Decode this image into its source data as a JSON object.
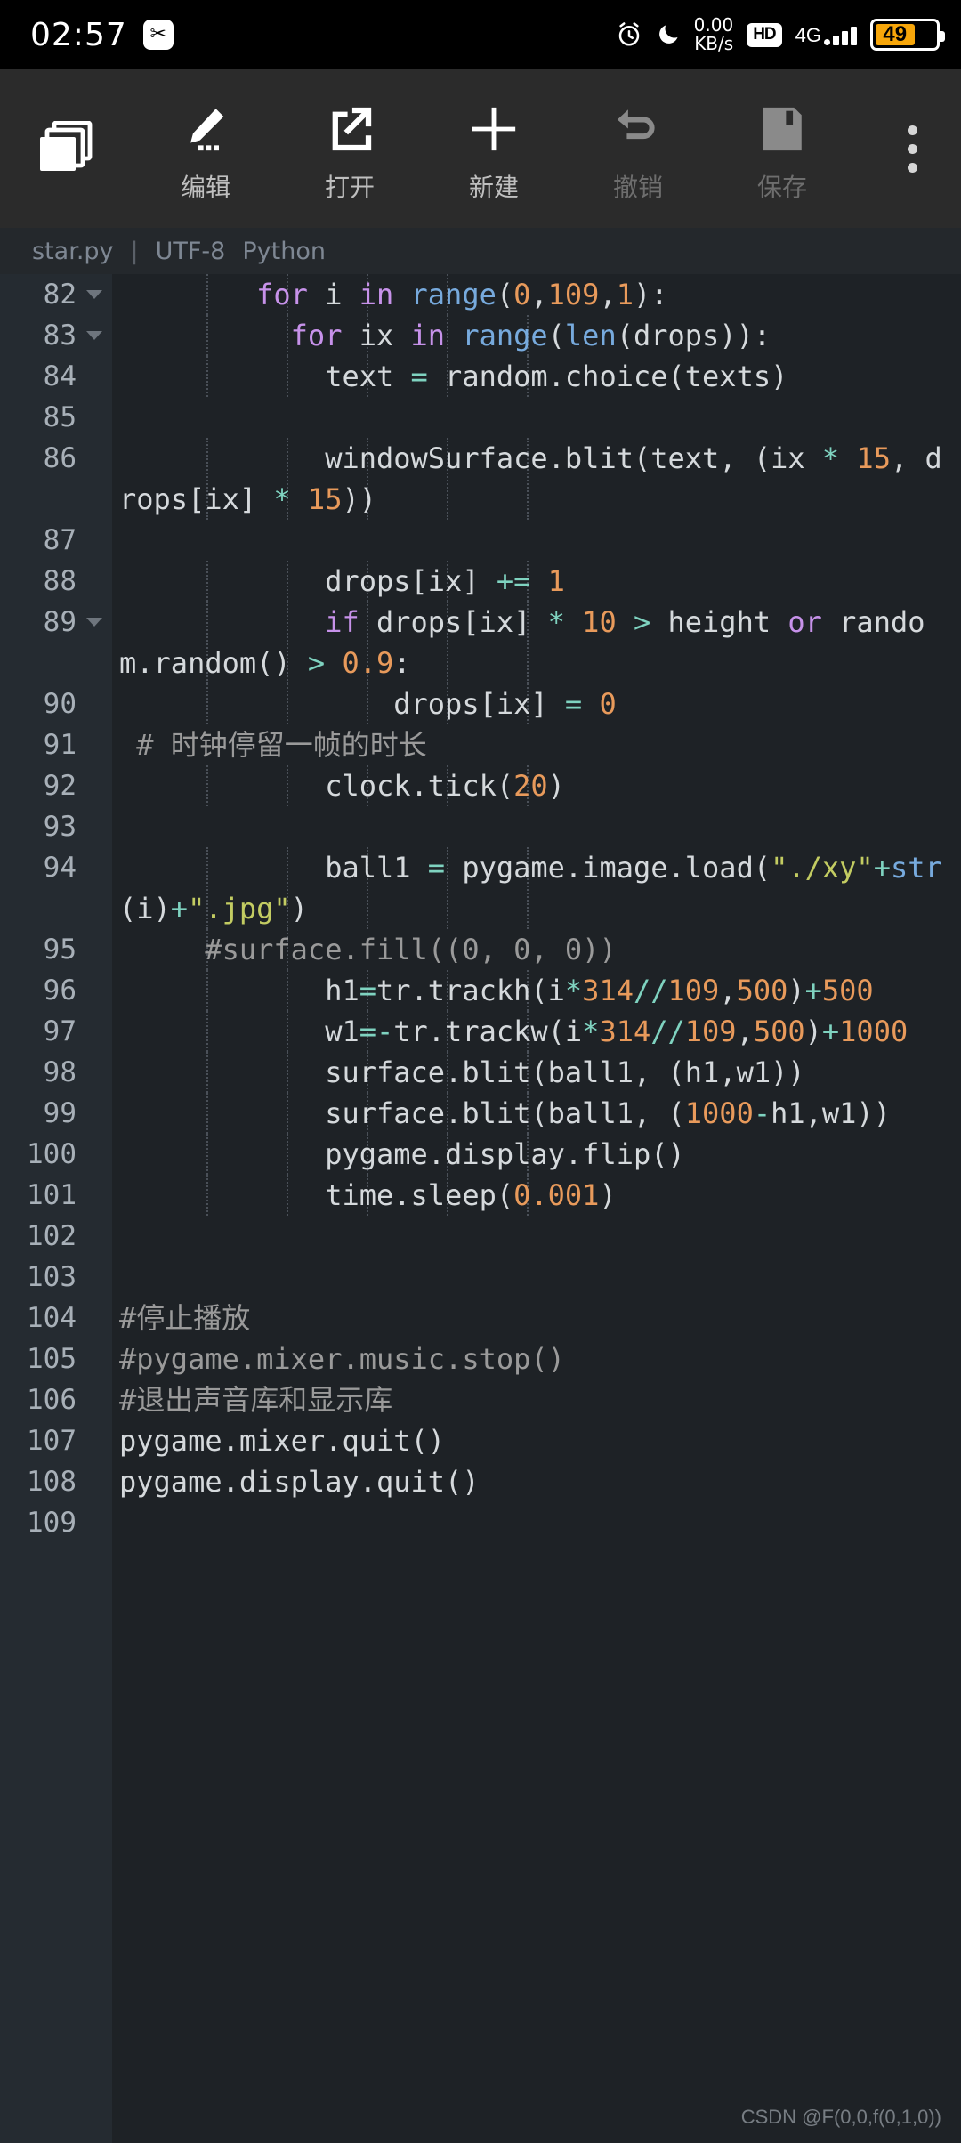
{
  "statusbar": {
    "time": "02:57",
    "scissor_icon": "screenshot-scissors-icon",
    "alarm_icon": "alarm-clock-icon",
    "dnd_icon": "moon-do-not-disturb-icon",
    "netspeed_value": "0.00",
    "netspeed_unit": "KB/s",
    "hd_label": "HD",
    "network_label": "4G",
    "signal_bars": 4,
    "battery_percent": "49",
    "battery_color": "#F7A60A"
  },
  "toolbar": {
    "tabs_icon": "file-tabs-icon",
    "items": [
      {
        "label": "编辑",
        "icon": "pencil-edit-icon",
        "enabled": true
      },
      {
        "label": "打开",
        "icon": "open-external-icon",
        "enabled": true
      },
      {
        "label": "新建",
        "icon": "plus-new-icon",
        "enabled": true
      },
      {
        "label": "撤销",
        "icon": "undo-arrow-icon",
        "enabled": false
      },
      {
        "label": "保存",
        "icon": "floppy-save-icon",
        "enabled": false
      }
    ],
    "more_icon": "overflow-menu-icon"
  },
  "fileinfo": {
    "filename": "star.py",
    "separator": "|",
    "encoding": "UTF-8",
    "language": "Python"
  },
  "editor": {
    "first_line": 82,
    "last_line": 109,
    "colors": {
      "background": "#1E2226",
      "gutter": "#252B31",
      "text": "#D5D9DC",
      "keyword": "#C792EA",
      "function": "#77AADD",
      "number": "#E89A5B",
      "operator": "#7FD3C0",
      "string": "#C3CC62",
      "comment": "#9A9A9A",
      "linenumber": "#A8B0B8"
    },
    "lines": [
      {
        "n": 82,
        "fold": true,
        "tokens": [
          {
            "t": "        ",
            "c": "pl"
          },
          {
            "t": "for",
            "c": "kw"
          },
          {
            "t": " i ",
            "c": "pl"
          },
          {
            "t": "in",
            "c": "kw"
          },
          {
            "t": " ",
            "c": "pl"
          },
          {
            "t": "range",
            "c": "fn"
          },
          {
            "t": "(",
            "c": "pl"
          },
          {
            "t": "0",
            "c": "num-t"
          },
          {
            "t": ",",
            "c": "pl"
          },
          {
            "t": "109",
            "c": "num-t"
          },
          {
            "t": ",",
            "c": "pl"
          },
          {
            "t": "1",
            "c": "num-t"
          },
          {
            "t": "):",
            "c": "pl"
          }
        ]
      },
      {
        "n": 83,
        "fold": true,
        "tokens": [
          {
            "t": "          ",
            "c": "pl"
          },
          {
            "t": "for",
            "c": "kw"
          },
          {
            "t": " ix ",
            "c": "pl"
          },
          {
            "t": "in",
            "c": "kw"
          },
          {
            "t": " ",
            "c": "pl"
          },
          {
            "t": "range",
            "c": "fn"
          },
          {
            "t": "(",
            "c": "pl"
          },
          {
            "t": "len",
            "c": "fn"
          },
          {
            "t": "(drops)):",
            "c": "pl"
          }
        ]
      },
      {
        "n": 84,
        "fold": false,
        "tokens": [
          {
            "t": "            text ",
            "c": "pl"
          },
          {
            "t": "=",
            "c": "op"
          },
          {
            "t": " random.choice(texts)",
            "c": "pl"
          }
        ]
      },
      {
        "n": 85,
        "fold": false,
        "tokens": [
          {
            "t": "",
            "c": "pl"
          }
        ]
      },
      {
        "n": 86,
        "fold": false,
        "tokens": [
          {
            "t": "            windowSurface.blit(text, (ix ",
            "c": "pl"
          },
          {
            "t": "*",
            "c": "op"
          },
          {
            "t": " ",
            "c": "pl"
          },
          {
            "t": "15",
            "c": "num-t"
          },
          {
            "t": ", drops[ix] ",
            "c": "pl"
          },
          {
            "t": "*",
            "c": "op"
          },
          {
            "t": " ",
            "c": "pl"
          },
          {
            "t": "15",
            "c": "num-t"
          },
          {
            "t": "))",
            "c": "pl"
          }
        ]
      },
      {
        "n": 87,
        "fold": false,
        "tokens": [
          {
            "t": "",
            "c": "pl"
          }
        ]
      },
      {
        "n": 88,
        "fold": false,
        "tokens": [
          {
            "t": "            drops[ix] ",
            "c": "pl"
          },
          {
            "t": "+=",
            "c": "op"
          },
          {
            "t": " ",
            "c": "pl"
          },
          {
            "t": "1",
            "c": "num-t"
          }
        ]
      },
      {
        "n": 89,
        "fold": true,
        "tokens": [
          {
            "t": "            ",
            "c": "pl"
          },
          {
            "t": "if",
            "c": "kw"
          },
          {
            "t": " drops[ix] ",
            "c": "pl"
          },
          {
            "t": "*",
            "c": "op"
          },
          {
            "t": " ",
            "c": "pl"
          },
          {
            "t": "10",
            "c": "num-t"
          },
          {
            "t": " ",
            "c": "pl"
          },
          {
            "t": ">",
            "c": "op"
          },
          {
            "t": " height ",
            "c": "pl"
          },
          {
            "t": "or",
            "c": "kw"
          },
          {
            "t": " random.random() ",
            "c": "pl"
          },
          {
            "t": ">",
            "c": "op"
          },
          {
            "t": " ",
            "c": "pl"
          },
          {
            "t": "0.9",
            "c": "num-t"
          },
          {
            "t": ":",
            "c": "pl"
          }
        ]
      },
      {
        "n": 90,
        "fold": false,
        "tokens": [
          {
            "t": "                drops[ix] ",
            "c": "pl"
          },
          {
            "t": "=",
            "c": "op"
          },
          {
            "t": " ",
            "c": "pl"
          },
          {
            "t": "0",
            "c": "num-t"
          }
        ]
      },
      {
        "n": 91,
        "fold": false,
        "tokens": [
          {
            "t": " # 时钟停留一帧的时长",
            "c": "cmt"
          }
        ]
      },
      {
        "n": 92,
        "fold": false,
        "tokens": [
          {
            "t": "            clock.tick(",
            "c": "pl"
          },
          {
            "t": "20",
            "c": "num-t"
          },
          {
            "t": ")",
            "c": "pl"
          }
        ]
      },
      {
        "n": 93,
        "fold": false,
        "tokens": [
          {
            "t": "",
            "c": "pl"
          }
        ]
      },
      {
        "n": 94,
        "fold": false,
        "tokens": [
          {
            "t": "            ball1 ",
            "c": "pl"
          },
          {
            "t": "=",
            "c": "op"
          },
          {
            "t": " pygame.image.load(",
            "c": "pl"
          },
          {
            "t": "\"./xy\"",
            "c": "str"
          },
          {
            "t": "+",
            "c": "op"
          },
          {
            "t": "str",
            "c": "fn"
          },
          {
            "t": "(i)",
            "c": "pl"
          },
          {
            "t": "+",
            "c": "op"
          },
          {
            "t": "\".jpg\"",
            "c": "str"
          },
          {
            "t": ")",
            "c": "pl"
          }
        ]
      },
      {
        "n": 95,
        "fold": false,
        "tokens": [
          {
            "t": "     #surface.fill((0, 0, 0))",
            "c": "cmt"
          }
        ]
      },
      {
        "n": 96,
        "fold": false,
        "tokens": [
          {
            "t": "            h1",
            "c": "pl"
          },
          {
            "t": "=",
            "c": "op"
          },
          {
            "t": "tr.trackh(i",
            "c": "pl"
          },
          {
            "t": "*",
            "c": "op"
          },
          {
            "t": "314",
            "c": "num-t"
          },
          {
            "t": "//",
            "c": "op"
          },
          {
            "t": "109",
            "c": "num-t"
          },
          {
            "t": ",",
            "c": "pl"
          },
          {
            "t": "500",
            "c": "num-t"
          },
          {
            "t": ")",
            "c": "pl"
          },
          {
            "t": "+",
            "c": "op"
          },
          {
            "t": "500",
            "c": "num-t"
          }
        ]
      },
      {
        "n": 97,
        "fold": false,
        "tokens": [
          {
            "t": "            w1",
            "c": "pl"
          },
          {
            "t": "=-",
            "c": "op"
          },
          {
            "t": "tr.trackw(i",
            "c": "pl"
          },
          {
            "t": "*",
            "c": "op"
          },
          {
            "t": "314",
            "c": "num-t"
          },
          {
            "t": "//",
            "c": "op"
          },
          {
            "t": "109",
            "c": "num-t"
          },
          {
            "t": ",",
            "c": "pl"
          },
          {
            "t": "500",
            "c": "num-t"
          },
          {
            "t": ")",
            "c": "pl"
          },
          {
            "t": "+",
            "c": "op"
          },
          {
            "t": "1000",
            "c": "num-t"
          }
        ]
      },
      {
        "n": 98,
        "fold": false,
        "tokens": [
          {
            "t": "            surface.blit(ball1, (h1,w1))",
            "c": "pl"
          }
        ]
      },
      {
        "n": 99,
        "fold": false,
        "tokens": [
          {
            "t": "            surface.blit(ball1, (",
            "c": "pl"
          },
          {
            "t": "1000",
            "c": "num-t"
          },
          {
            "t": "-",
            "c": "op"
          },
          {
            "t": "h1,w1))",
            "c": "pl"
          }
        ]
      },
      {
        "n": 100,
        "fold": false,
        "tokens": [
          {
            "t": "            pygame.display.flip()",
            "c": "pl"
          }
        ]
      },
      {
        "n": 101,
        "fold": false,
        "tokens": [
          {
            "t": "            time.sleep(",
            "c": "pl"
          },
          {
            "t": "0.001",
            "c": "num-t"
          },
          {
            "t": ")",
            "c": "pl"
          }
        ]
      },
      {
        "n": 102,
        "fold": false,
        "tokens": [
          {
            "t": "",
            "c": "pl"
          }
        ]
      },
      {
        "n": 103,
        "fold": false,
        "tokens": [
          {
            "t": "",
            "c": "pl"
          }
        ]
      },
      {
        "n": 104,
        "fold": false,
        "tokens": [
          {
            "t": "#停止播放",
            "c": "cmt"
          }
        ]
      },
      {
        "n": 105,
        "fold": false,
        "tokens": [
          {
            "t": "#pygame.mixer.music.stop()",
            "c": "cmt"
          }
        ]
      },
      {
        "n": 106,
        "fold": false,
        "tokens": [
          {
            "t": "#退出声音库和显示库",
            "c": "cmt"
          }
        ]
      },
      {
        "n": 107,
        "fold": false,
        "tokens": [
          {
            "t": "pygame.mixer.quit()",
            "c": "pl"
          }
        ]
      },
      {
        "n": 108,
        "fold": false,
        "tokens": [
          {
            "t": "pygame.display.quit()",
            "c": "pl"
          }
        ]
      },
      {
        "n": 109,
        "fold": false,
        "tokens": [
          {
            "t": "",
            "c": "pl"
          }
        ]
      }
    ],
    "indent_guides_x": [
      232,
      322,
      412,
      502,
      592
    ]
  },
  "watermark": "CSDN @F(0,0,f(0,1,0))"
}
